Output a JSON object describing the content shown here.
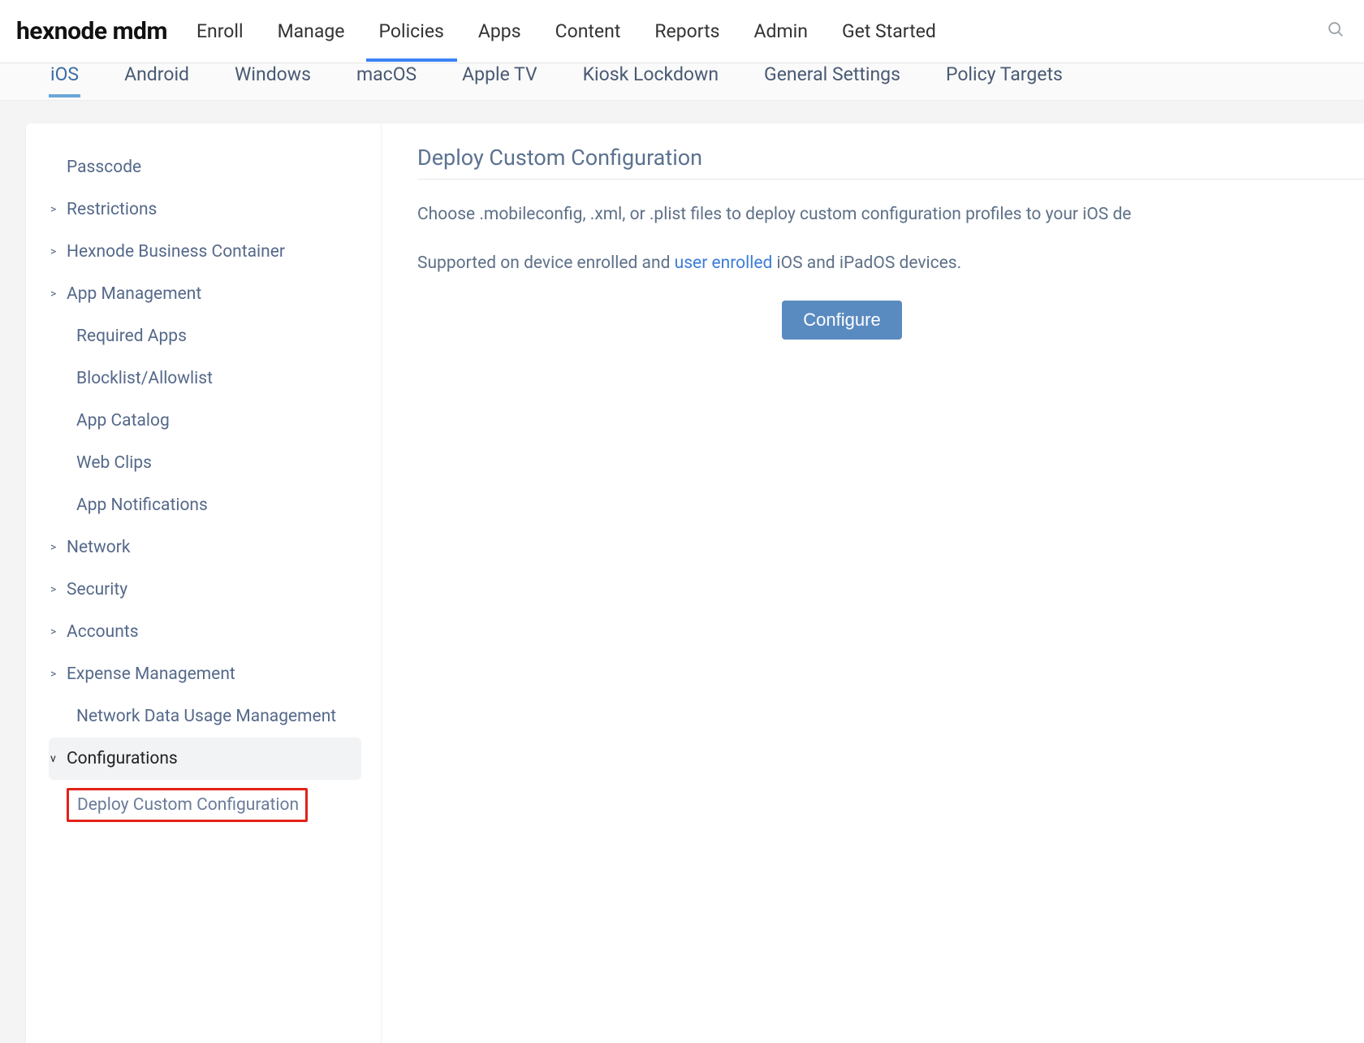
{
  "brand": "hexnode mdm",
  "mainnav": {
    "items": [
      {
        "label": "Enroll"
      },
      {
        "label": "Manage"
      },
      {
        "label": "Policies"
      },
      {
        "label": "Apps"
      },
      {
        "label": "Content"
      },
      {
        "label": "Reports"
      },
      {
        "label": "Admin"
      },
      {
        "label": "Get Started"
      }
    ],
    "active_index": 2
  },
  "platform_tabs": {
    "items": [
      {
        "label": "iOS"
      },
      {
        "label": "Android"
      },
      {
        "label": "Windows"
      },
      {
        "label": "macOS"
      },
      {
        "label": "Apple TV"
      },
      {
        "label": "Kiosk Lockdown"
      },
      {
        "label": "General Settings"
      },
      {
        "label": "Policy Targets"
      }
    ],
    "active_index": 0
  },
  "sidebar": {
    "items": [
      {
        "label": "Passcode",
        "level": 1,
        "caret": ""
      },
      {
        "label": "Restrictions",
        "level": 1,
        "caret": ">"
      },
      {
        "label": "Hexnode Business Container",
        "level": 1,
        "caret": ">"
      },
      {
        "label": "App Management",
        "level": 1,
        "caret": ">"
      },
      {
        "label": "Required Apps",
        "level": 2,
        "caret": ""
      },
      {
        "label": "Blocklist/Allowlist",
        "level": 2,
        "caret": ""
      },
      {
        "label": "App Catalog",
        "level": 2,
        "caret": ""
      },
      {
        "label": "Web Clips",
        "level": 2,
        "caret": ""
      },
      {
        "label": "App Notifications",
        "level": 2,
        "caret": ""
      },
      {
        "label": "Network",
        "level": 1,
        "caret": ">"
      },
      {
        "label": "Security",
        "level": 1,
        "caret": ">"
      },
      {
        "label": "Accounts",
        "level": 1,
        "caret": ">"
      },
      {
        "label": "Expense Management",
        "level": 1,
        "caret": ">"
      },
      {
        "label": "Network Data Usage Management",
        "level": 2,
        "caret": ""
      },
      {
        "label": "Configurations",
        "level": 1,
        "caret": "v",
        "selected": true
      },
      {
        "label": "Deploy Custom Configuration",
        "level": 2,
        "caret": "",
        "highlight": true
      }
    ]
  },
  "main": {
    "title": "Deploy Custom Configuration",
    "desc_part1": "Choose .mobileconfig, .xml, or .plist files to deploy custom configuration profiles to your iOS de",
    "desc_part2a": "Supported on device enrolled and ",
    "desc_part2_link": "user enrolled",
    "desc_part2b": " iOS and iPadOS devices.",
    "configure_label": "Configure"
  }
}
